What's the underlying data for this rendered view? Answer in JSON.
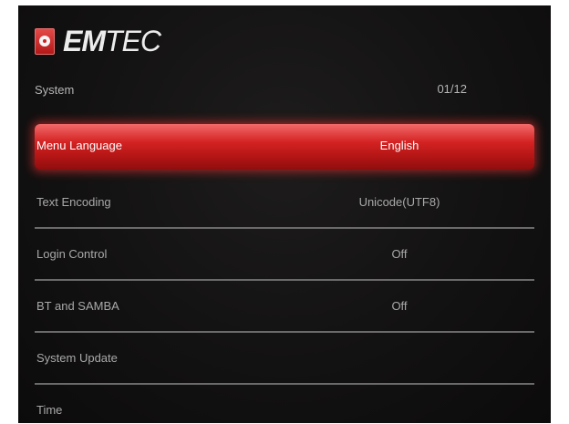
{
  "brand": {
    "name_bold": "EM",
    "name_thin": "TEC",
    "icon": "emtec-logo-icon"
  },
  "header": {
    "section_title": "System",
    "page_counter": "01/12"
  },
  "menu": {
    "items": [
      {
        "label": "Menu Language",
        "value": "English",
        "selected": true
      },
      {
        "label": "Text Encoding",
        "value": "Unicode(UTF8)",
        "selected": false
      },
      {
        "label": "Login Control",
        "value": "Off",
        "selected": false
      },
      {
        "label": "BT and SAMBA",
        "value": "Off",
        "selected": false
      },
      {
        "label": "System Update",
        "value": "",
        "selected": false
      },
      {
        "label": "Time",
        "value": "",
        "selected": false
      }
    ]
  },
  "colors": {
    "background": "#131212",
    "highlight": "#d42222",
    "text": "#a9a9a9",
    "divider": "#6a6a6a"
  }
}
